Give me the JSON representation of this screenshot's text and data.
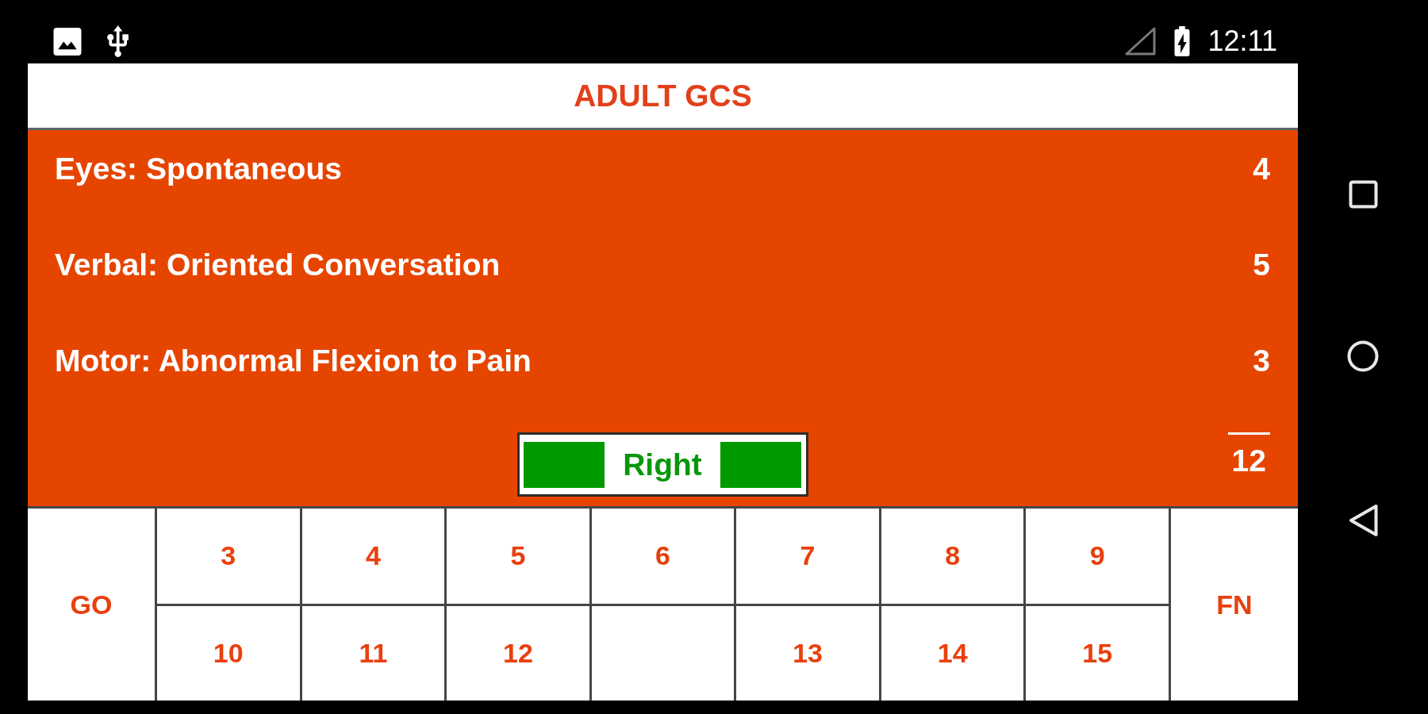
{
  "status_bar": {
    "time": "12:11"
  },
  "title": "ADULT GCS",
  "scores": [
    {
      "label": "Eyes: Spontaneous",
      "value": "4"
    },
    {
      "label": "Verbal: Oriented Conversation",
      "value": "5"
    },
    {
      "label": "Motor: Abnormal Flexion to Pain",
      "value": "3"
    }
  ],
  "side_toggle": {
    "label": "Right"
  },
  "total": "12",
  "keypad": {
    "left_key": "GO",
    "right_key": "FN",
    "rows": [
      [
        {
          "kind": "number",
          "label": "3"
        },
        {
          "kind": "number",
          "label": "4"
        },
        {
          "kind": "number",
          "label": "5"
        },
        {
          "kind": "number",
          "label": "6"
        },
        {
          "kind": "number",
          "label": "7"
        },
        {
          "kind": "number",
          "label": "8"
        },
        {
          "kind": "number",
          "label": "9"
        }
      ],
      [
        {
          "kind": "number",
          "label": "10"
        },
        {
          "kind": "number",
          "label": "11"
        },
        {
          "kind": "number",
          "label": "12"
        },
        {
          "kind": "blank"
        },
        {
          "kind": "number",
          "label": "13"
        },
        {
          "kind": "number",
          "label": "14"
        },
        {
          "kind": "number",
          "label": "15"
        }
      ]
    ]
  }
}
